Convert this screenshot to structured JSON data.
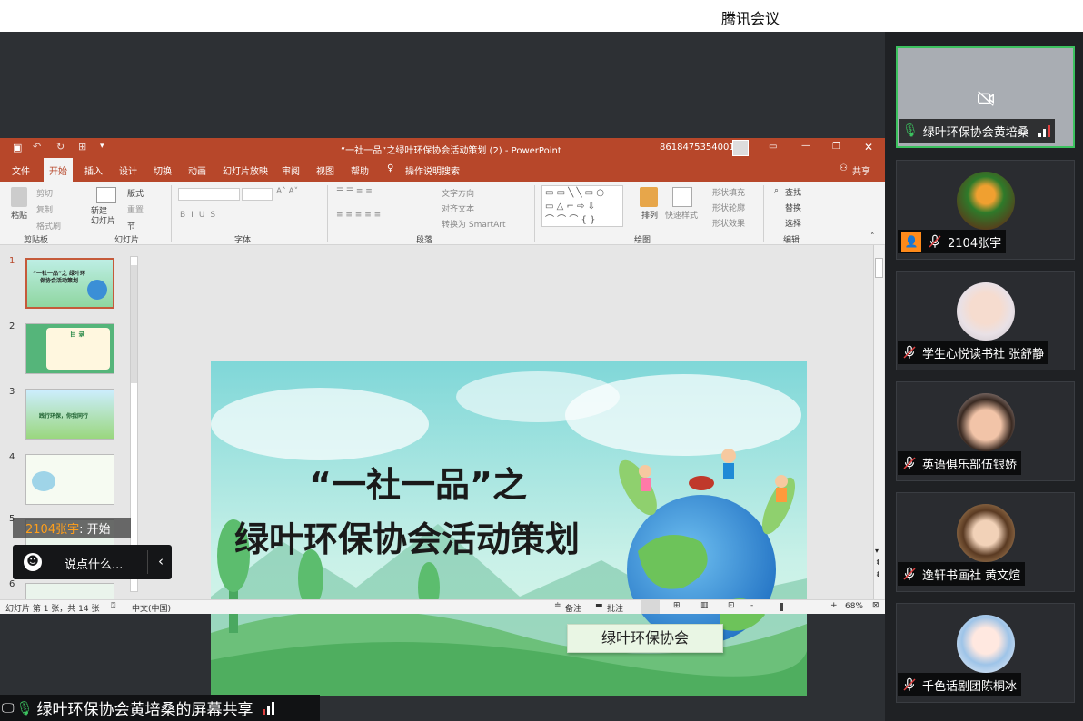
{
  "app": {
    "title": "腾讯会议"
  },
  "share": {
    "label": "绿叶环保协会黄培桑的屏幕共享"
  },
  "chat": {
    "placeholder": "说点什么...",
    "recent_user": "2104张宇",
    "recent_text": ": 开始"
  },
  "participants": [
    {
      "name": "绿叶环保协会黄培桑",
      "mic": "on",
      "video": "off"
    },
    {
      "name": "2104张宇",
      "mic": "off"
    },
    {
      "name": "学生心悦读书社 张舒静",
      "mic": "off"
    },
    {
      "name": "英语俱乐部伍银娇",
      "mic": "off"
    },
    {
      "name": "逸轩书画社 黄文煊",
      "mic": "off"
    },
    {
      "name": "千色话剧团陈桐冰",
      "mic": "off"
    }
  ],
  "ppt": {
    "window_title": "“一社一品”之绿叶环保协会活动策划 (2)  -  PowerPoint",
    "account": "8618475354001",
    "menu": [
      "文件",
      "开始",
      "插入",
      "设计",
      "切换",
      "动画",
      "幻灯片放映",
      "审阅",
      "视图",
      "帮助"
    ],
    "tell_me": "操作说明搜索",
    "share": "共享",
    "ribbon": {
      "paste": "粘贴",
      "cut": "剪切",
      "copy": "复制",
      "format_painter": "格式刷",
      "new_slide": "新建\n幻灯片",
      "layout": "版式",
      "reset": "重置",
      "section": "节",
      "text_direction": "文字方向",
      "align_text": "对齐文本",
      "convert_smartart": "转换为 SmartArt",
      "arrange": "排列",
      "quick_styles": "快速样式",
      "shape_fill": "形状填充",
      "shape_outline": "形状轮廓",
      "shape_effects": "形状效果",
      "find": "查找",
      "replace": "替换",
      "select": "选择",
      "groups": [
        "剪贴板",
        "幻灯片",
        "字体",
        "段落",
        "绘图",
        "编辑"
      ]
    },
    "slide": {
      "title_line1": "“一社一品”之",
      "title_line2": "绿叶环保协会活动策划",
      "badge": "绿叶环保协会"
    },
    "thumbnails": [
      {
        "num": "1",
        "text": "“一社一品”之 绿叶环保协会活动策划"
      },
      {
        "num": "2",
        "text": "目 录"
      },
      {
        "num": "3",
        "text": "践行环保，你我同行"
      },
      {
        "num": "4",
        "text": ""
      },
      {
        "num": "5",
        "text": ""
      },
      {
        "num": "6",
        "text": ""
      }
    ],
    "status": {
      "slide_info": "幻灯片 第 1 张，共 14 张",
      "language": "中文(中国)",
      "notes": "备注",
      "comments": "批注",
      "zoom": "68%"
    }
  },
  "colors": {
    "ppt_accent": "#b7472a",
    "active_speaker": "#3cc25f"
  }
}
